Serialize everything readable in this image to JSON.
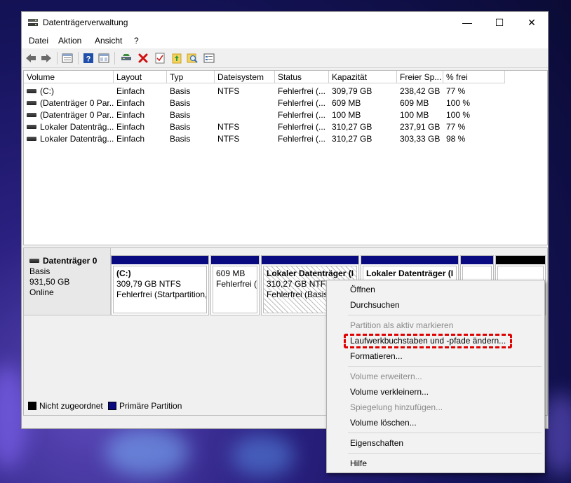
{
  "window": {
    "title": "Datenträgerverwaltung",
    "controls": {
      "minimize": "—",
      "maximize": "☐",
      "close": "✕"
    }
  },
  "menu": [
    "Datei",
    "Aktion",
    "Ansicht",
    "?"
  ],
  "toolbar_icons": [
    "back-icon",
    "forward-icon",
    "properties-icon",
    "help-icon",
    "list-view-icon",
    "connect-icon",
    "delete-icon",
    "check-icon",
    "open-folder-icon",
    "search-icon",
    "settings-list-icon"
  ],
  "volume_list": {
    "columns": [
      "Volume",
      "Layout",
      "Typ",
      "Dateisystem",
      "Status",
      "Kapazität",
      "Freier Sp...",
      "% frei"
    ],
    "rows": [
      [
        "(C:)",
        "Einfach",
        "Basis",
        "NTFS",
        "Fehlerfrei (...",
        "309,79 GB",
        "238,42 GB",
        "77 %"
      ],
      [
        "(Datenträger 0 Par...",
        "Einfach",
        "Basis",
        "",
        "Fehlerfrei (...",
        "609 MB",
        "609 MB",
        "100 %"
      ],
      [
        "(Datenträger 0 Par...",
        "Einfach",
        "Basis",
        "",
        "Fehlerfrei (...",
        "100 MB",
        "100 MB",
        "100 %"
      ],
      [
        "Lokaler Datenträg...",
        "Einfach",
        "Basis",
        "NTFS",
        "Fehlerfrei (...",
        "310,27 GB",
        "237,91 GB",
        "77 %"
      ],
      [
        "Lokaler Datenträg...",
        "Einfach",
        "Basis",
        "NTFS",
        "Fehlerfrei (...",
        "310,27 GB",
        "303,33 GB",
        "98 %"
      ]
    ]
  },
  "disk": {
    "name": "Datenträger 0",
    "type": "Basis",
    "size": "931,50 GB",
    "state": "Online",
    "volumes": [
      {
        "name": "(C:)",
        "line2": "309,79 GB NTFS",
        "line3": "Fehlerfrei (Startpartition,",
        "hatched": false
      },
      {
        "name": "",
        "line2": "609 MB",
        "line3": "Fehlerfrei (",
        "hatched": false
      },
      {
        "name": "Lokaler Datenträger  (I",
        "line2": "310,27 GB NTFS",
        "line3": "Fehlerfrei (Basisd",
        "hatched": true
      },
      {
        "name": "Lokaler Datenträger  (I",
        "line2": "",
        "line3": "",
        "hatched": false
      },
      {
        "name": "",
        "line2": "",
        "line3": "",
        "hatched": false
      },
      {
        "name": "",
        "line2": "",
        "line3": "",
        "hatched": false
      }
    ]
  },
  "legend": [
    {
      "label": "Nicht zugeordnet",
      "color": "#000000"
    },
    {
      "label": "Primäre Partition",
      "color": "#0a0a80"
    }
  ],
  "context_menu": {
    "items": [
      {
        "label": "Öffnen",
        "disabled": false
      },
      {
        "label": "Durchsuchen",
        "disabled": false
      },
      {
        "label": "Partition als aktiv markieren",
        "disabled": true
      },
      {
        "label": "Laufwerkbuchstaben und -pfade ändern...",
        "disabled": false,
        "highlighted": true
      },
      {
        "label": "Formatieren...",
        "disabled": false
      },
      {
        "label": "Volume erweitern...",
        "disabled": true
      },
      {
        "label": "Volume verkleinern...",
        "disabled": false
      },
      {
        "label": "Spiegelung hinzufügen...",
        "disabled": true
      },
      {
        "label": "Volume löschen...",
        "disabled": false
      },
      {
        "label": "Eigenschaften",
        "disabled": false
      },
      {
        "label": "Hilfe",
        "disabled": false
      }
    ],
    "highlight_color": "#e00000"
  }
}
